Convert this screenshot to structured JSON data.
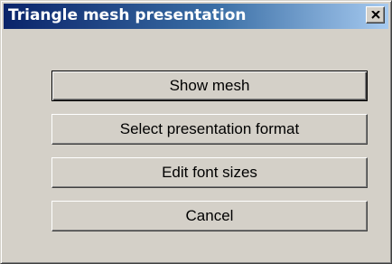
{
  "window": {
    "title": "Triangle mesh presentation"
  },
  "buttons": {
    "show_mesh": "Show mesh",
    "select_format": "Select presentation format",
    "edit_fonts": "Edit font sizes",
    "cancel": "Cancel"
  },
  "icons": {
    "close": "close-icon"
  },
  "colors": {
    "titlebar_start": "#0a246a",
    "titlebar_end": "#a6caf0",
    "face": "#d4d0c8"
  }
}
